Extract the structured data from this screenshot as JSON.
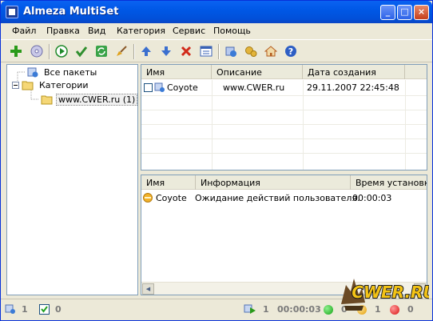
{
  "window": {
    "title": "Almeza MultiSet",
    "min": "_",
    "max": "□",
    "close": "×"
  },
  "menu": [
    "Файл",
    "Правка",
    "Вид",
    "Категория",
    "Сервис",
    "Помощь"
  ],
  "toolbar": {
    "icons": [
      "add-icon",
      "disc-icon",
      "run-icon",
      "check-icon",
      "refresh-icon",
      "clean-icon",
      "arrow-up-icon",
      "arrow-down-icon",
      "delete-icon",
      "properties-icon",
      "install-icon",
      "settings-icon",
      "home-icon",
      "help-icon"
    ]
  },
  "tree": {
    "all_packages": "Все пакеты",
    "categories": "Категории",
    "folder": "www.CWER.ru (1)"
  },
  "packages": {
    "columns": [
      "Имя",
      "Описание",
      "Дата создания"
    ],
    "rows": [
      {
        "name": "Coyote",
        "description": "www.CWER.ru",
        "date": "29.11.2007 22:45:48"
      }
    ]
  },
  "tasks": {
    "columns": [
      "Имя",
      "Информация",
      "Время установки"
    ],
    "rows": [
      {
        "name": "Coyote",
        "info": "Ожидание действий пользователя.",
        "time": "00:00:03"
      }
    ]
  },
  "status": {
    "packages_count": "1",
    "checked_count": "0",
    "running_count": "1",
    "elapsed": "00:00:03",
    "green_count": "0",
    "yellow_count": "1",
    "red_count": "0"
  },
  "watermark": "CWER.RU"
}
